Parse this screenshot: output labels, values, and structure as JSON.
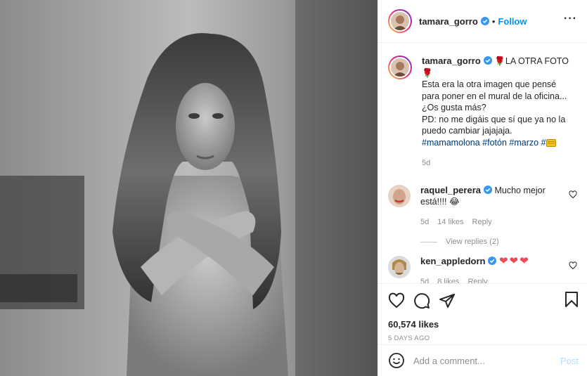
{
  "post": {
    "author": "tamara_gorro",
    "follow_label": "Follow",
    "more_icon": "more-horizontal-icon",
    "separator": "•"
  },
  "caption": {
    "author": "tamara_gorro",
    "title_text": "LA OTRA FOTO",
    "line1": "Esta era la otra imagen que pensé",
    "line2": "para poner en el mural de la oficina...",
    "line3": "¿Os gusta más?",
    "line4": "PD: no me digáis que sí que ya no la",
    "line5": "puedo cambiar jajajaja.",
    "hashtags": [
      "#mamamolona",
      "#fotón",
      "#marzo",
      "#"
    ],
    "time": "5d"
  },
  "comments": [
    {
      "author": "raquel_perera",
      "text_line1": "Mucho mejor",
      "text_line2": "está!!!!",
      "time": "5d",
      "likes": "14 likes",
      "reply": "Reply",
      "emoji": "laughing-emoji"
    },
    {
      "author": "ken_appledorn",
      "text": "❤❤❤",
      "time": "5d",
      "likes": "8 likes",
      "reply": "Reply"
    }
  ],
  "view_replies": "View replies (2)",
  "actions": {
    "icons": [
      "heart-icon",
      "comment-icon",
      "share-icon",
      "bookmark-icon"
    ],
    "likes_count": "60,574 likes",
    "time_ago": "5 DAYS AGO"
  },
  "comment_box": {
    "placeholder": "Add a comment...",
    "post_label": "Post",
    "emoji_icon": "smiley-icon"
  },
  "colors": {
    "accent": "#0095f6",
    "heart_red": "#ed4956",
    "hashtag": "#00376b",
    "muted": "#8e8e8e"
  }
}
